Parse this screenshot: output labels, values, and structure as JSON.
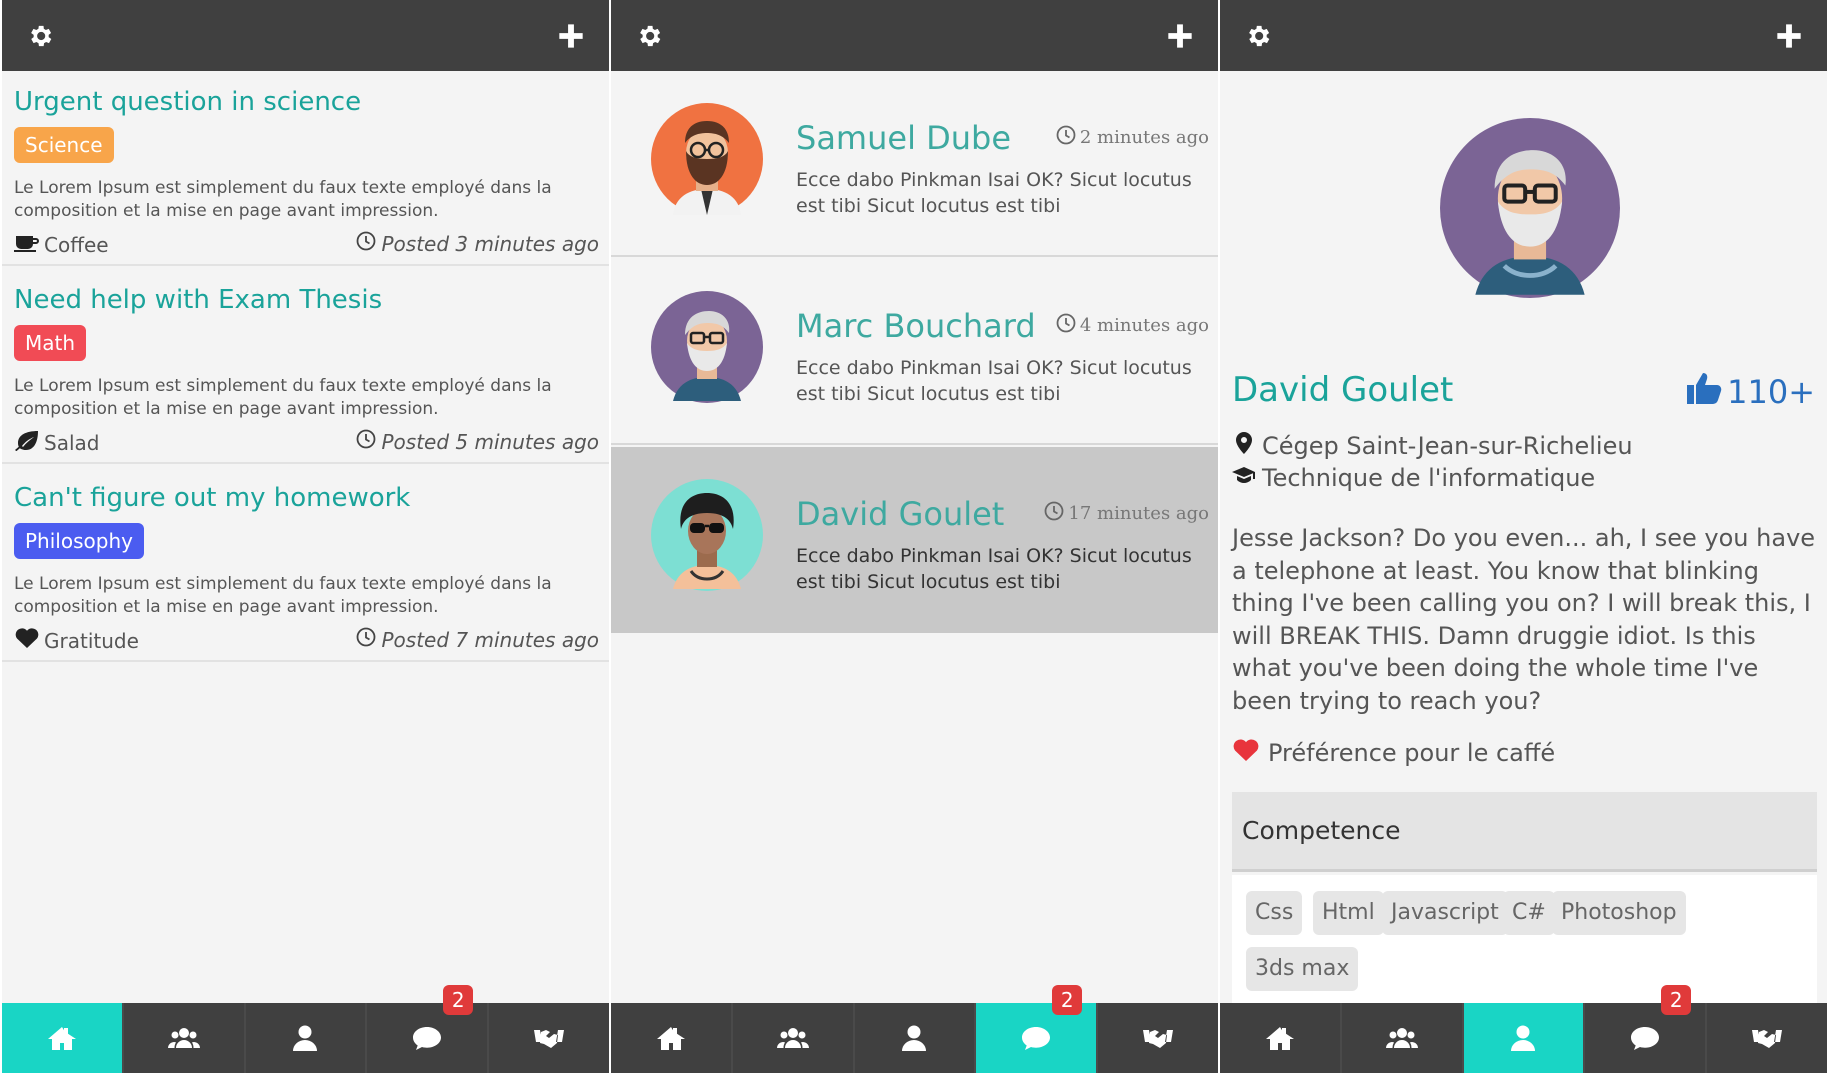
{
  "colors": {
    "teal": "#1aa39a",
    "topbar": "#404040",
    "active_nav": "#19d5c5",
    "badge": "#e03a3a",
    "tag_science": "#f8a54a",
    "tag_math": "#f14b55",
    "tag_philosophy": "#4b5cf0",
    "likes": "#2a6fbe"
  },
  "topbar": {
    "left_icon": "gear-icon",
    "right_icon": "plus-icon"
  },
  "feed": {
    "posts": [
      {
        "title": "Urgent question in science",
        "tag": "Science",
        "description": "Le Lorem Ipsum est simplement du faux texte employé dans la composition et la mise en page avant impression.",
        "category": "Coffee",
        "category_icon": "coffee-icon",
        "time": "Posted 3 minutes ago"
      },
      {
        "title": "Need help with Exam Thesis",
        "tag": "Math",
        "description": "Le Lorem Ipsum est simplement du faux texte employé dans la composition et la mise en page avant impression.",
        "category": "Salad",
        "category_icon": "leaf-icon",
        "time": "Posted 5 minutes ago"
      },
      {
        "title": "Can't figure out my homework",
        "tag": "Philosophy",
        "description": "Le Lorem Ipsum est simplement du faux texte employé dans la composition et la mise en page avant impression.",
        "category": "Gratitude",
        "category_icon": "heart-icon",
        "time": "Posted 7 minutes ago"
      }
    ]
  },
  "messages": {
    "items": [
      {
        "name": "Samuel Dube",
        "time": "2 minutes ago",
        "text": "Ecce dabo Pinkman Isai OK? Sicut locutus est tibi Sicut locutus est tibi"
      },
      {
        "name": "Marc Bouchard",
        "time": "4 minutes ago",
        "text": "Ecce dabo Pinkman Isai OK? Sicut locutus est tibi Sicut locutus est tibi"
      },
      {
        "name": "David Goulet",
        "time": "17 minutes ago",
        "text": "Ecce dabo Pinkman Isai OK? Sicut locutus est tibi Sicut locutus est tibi"
      }
    ]
  },
  "profile": {
    "name": "David Goulet",
    "likes": "110+",
    "school": "Cégep Saint-Jean-sur-Richelieu",
    "program": "Technique de l'informatique",
    "bio": "Jesse Jackson? Do you even... ah, I see you have a telephone at least. You know that blinking thing I've been calling you on? I will break this, I will BREAK THIS. Damn druggie idiot. Is this what you've been doing the whole time I've been trying to reach you?",
    "preference": "Préférence pour le caffé",
    "competence_title": "Competence",
    "skills": [
      "Css",
      "Html",
      "Javascript",
      "C#",
      "Photoshop",
      "3ds max"
    ]
  },
  "nav": {
    "items": [
      "home-icon",
      "group-icon",
      "user-icon",
      "chat-icon",
      "handshake-icon"
    ],
    "badge": "2"
  }
}
